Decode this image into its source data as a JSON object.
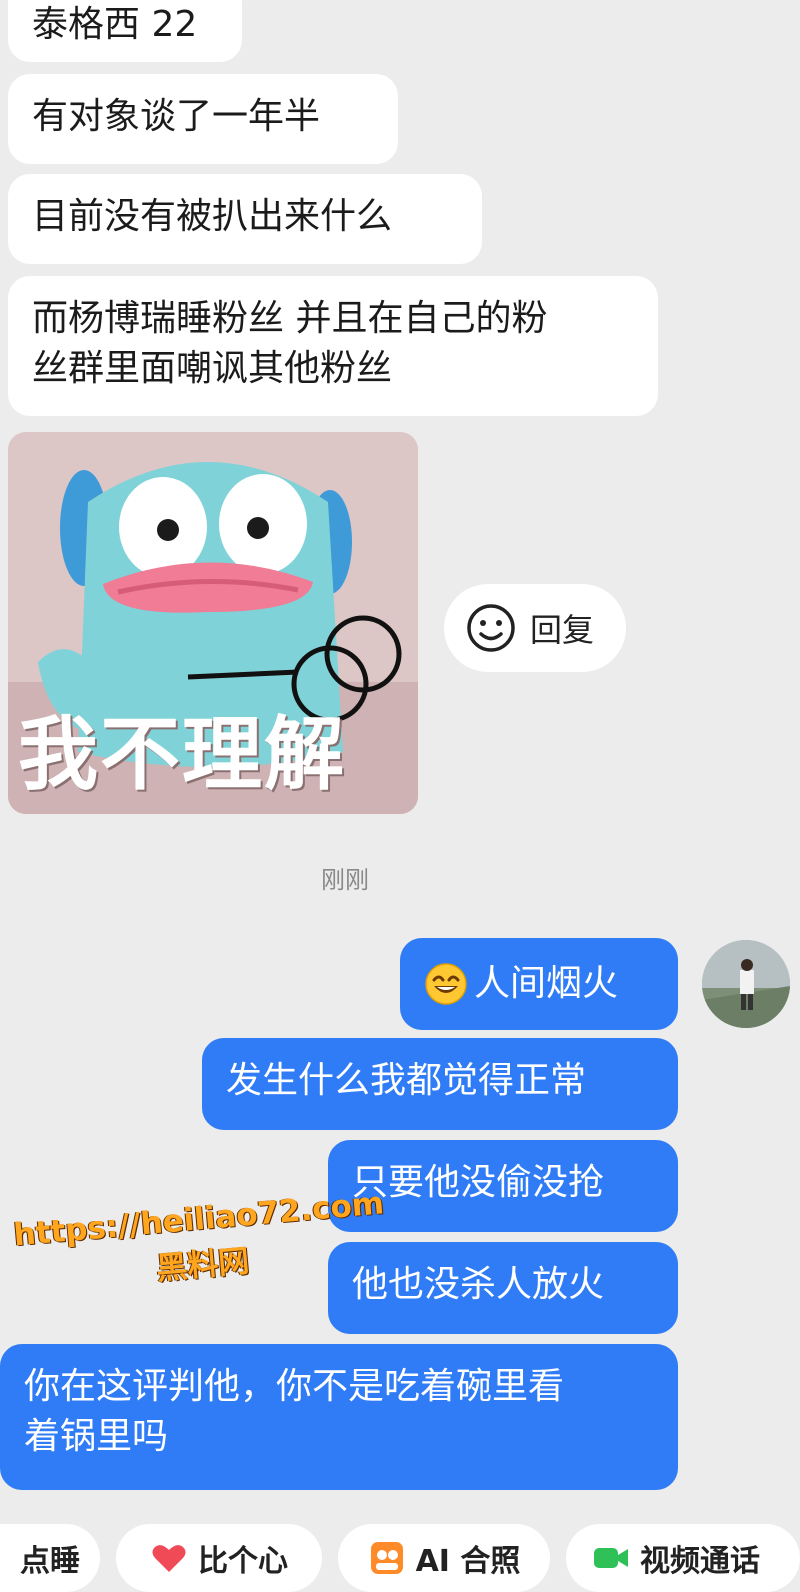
{
  "conversation": {
    "incoming": [
      "泰格西 22",
      "有对象谈了一年半",
      "目前没有被扒出来什么",
      "而杨博瑞睡粉丝 并且在自己的粉\n丝群里面嘲讽其他粉丝"
    ],
    "sticker_caption": "我不理解",
    "reply_label": "回复",
    "timestamp": "刚刚",
    "outgoing": [
      "人间烟火",
      "发生什么我都觉得正常",
      "只要他没偷没抢",
      "他也没杀人放火",
      "你在这评判他，你不是吃着碗里看\n着锅里吗"
    ]
  },
  "watermark": {
    "url": "https://heiliao72.com",
    "name": "黑料网"
  },
  "actions": [
    {
      "label": "点睡",
      "icon": "sleep-icon"
    },
    {
      "label": "比个心",
      "icon": "heart-icon"
    },
    {
      "label": "AI 合照",
      "icon": "ai-photo-icon"
    },
    {
      "label": "视频通话",
      "icon": "video-call-icon"
    }
  ],
  "colors": {
    "background": "#ececec",
    "incoming_bubble": "#ffffff",
    "outgoing_bubble": "#2f7cf6",
    "heart": "#f04a57",
    "ai_photo": "#ff8a2a",
    "video": "#2fc057",
    "watermark": "#ffa51e"
  }
}
